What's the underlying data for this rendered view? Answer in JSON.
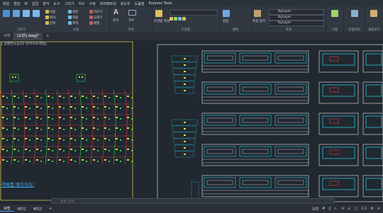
{
  "menu": [
    "파일",
    "편집",
    "뷰",
    "삽입",
    "형식",
    "도구",
    "그리기",
    "치수",
    "수정",
    "파라메트릭",
    "윈도우",
    "도움말",
    "Express Tools"
  ],
  "ribbon_groups": [
    {
      "label": "그리기"
    },
    {
      "label": "수정"
    },
    {
      "label": "주석"
    },
    {
      "label": "도면층"
    },
    {
      "label": "블록"
    },
    {
      "label": "특성"
    },
    {
      "label": "그룹"
    },
    {
      "label": "유틸리티"
    },
    {
      "label": "클립보드"
    }
  ],
  "ribbon_items": {
    "text": "문자",
    "dim": "치수",
    "layer_props": "도면층 특성",
    "insert": "삽입",
    "match": "특성 일치",
    "bylayer1": "ByLayer",
    "bylayer2": "ByLayer",
    "bylayer3": "ByLayer"
  },
  "tabs": [
    "시작",
    "[도면1.dwg]*"
  ],
  "viewport_label": "[-][평면도][2D 와이어프레임]",
  "canvas_hint": "객체를 배치하도!",
  "command_placeholder": "명령 입력",
  "layout_tabs": [
    "모형",
    "배치1",
    "배치2"
  ],
  "status_items": [
    "모형",
    "#",
    "||",
    "∟",
    "⊙",
    "∠",
    "□",
    "1:1",
    "⚙",
    "≡"
  ],
  "colors": {
    "green": "#2dd64a",
    "red": "#e0433a",
    "yellow": "#e6d84a",
    "cyan": "#26d8e6",
    "white": "#e4e6ea",
    "accent": "#3d8bff"
  }
}
